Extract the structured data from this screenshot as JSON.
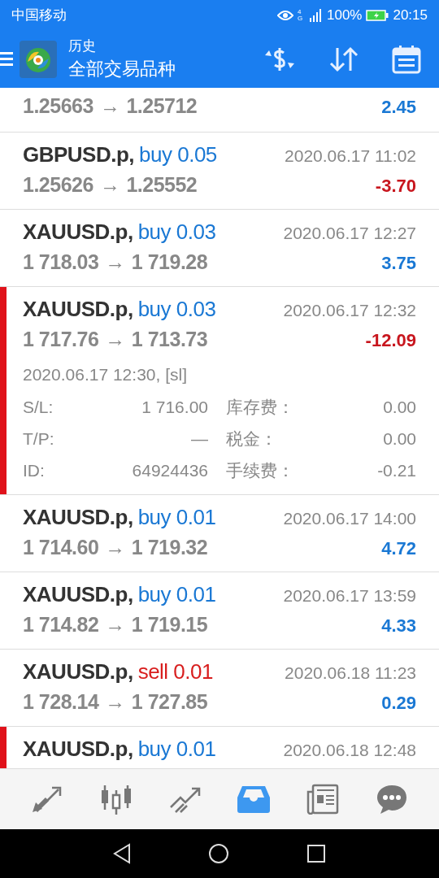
{
  "status_bar": {
    "carrier": "中国移动",
    "network": "4G",
    "battery": "100%",
    "time": "20:15"
  },
  "header": {
    "title": "历史",
    "subtitle": "全部交易品种"
  },
  "trades": [
    {
      "marked": false,
      "price_open": "1.25663",
      "arrow": "→",
      "price_close": "1.25712",
      "profit": "2.45",
      "loss": false
    },
    {
      "marked": false,
      "symbol": "GBPUSD.p,",
      "kind": "buy",
      "order": "buy 0.05",
      "time": "2020.06.17 11:02",
      "price_open": "1.25626",
      "arrow": "→",
      "price_close": "1.25552",
      "profit": "-3.70",
      "loss": true
    },
    {
      "marked": false,
      "symbol": "XAUUSD.p,",
      "kind": "buy",
      "order": "buy 0.03",
      "time": "2020.06.17 12:27",
      "price_open": "1 718.03",
      "arrow": "→",
      "price_close": "1 719.28",
      "profit": "3.75",
      "loss": false
    },
    {
      "marked": true,
      "symbol": "XAUUSD.p,",
      "kind": "buy",
      "order": "buy 0.03",
      "time": "2020.06.17 12:32",
      "price_open": "1 717.76",
      "arrow": "→",
      "price_close": "1 713.73",
      "profit": "-12.09",
      "loss": true,
      "details": {
        "close_info": "2020.06.17 12:30, [sl]",
        "fields": [
          [
            "S/L:",
            "1 716.00",
            "库存费：",
            "0.00"
          ],
          [
            "T/P:",
            "—",
            "税金：",
            "0.00"
          ],
          [
            "ID:",
            "64924436",
            "手续费：",
            "-0.21"
          ]
        ]
      }
    },
    {
      "marked": false,
      "symbol": "XAUUSD.p,",
      "kind": "buy",
      "order": "buy 0.01",
      "time": "2020.06.17 14:00",
      "price_open": "1 714.60",
      "arrow": "→",
      "price_close": "1 719.32",
      "profit": "4.72",
      "loss": false
    },
    {
      "marked": false,
      "symbol": "XAUUSD.p,",
      "kind": "buy",
      "order": "buy 0.01",
      "time": "2020.06.17 13:59",
      "price_open": "1 714.82",
      "arrow": "→",
      "price_close": "1 719.15",
      "profit": "4.33",
      "loss": false
    },
    {
      "marked": false,
      "symbol": "XAUUSD.p,",
      "kind": "sell",
      "order": "sell 0.01",
      "time": "2020.06.18 11:23",
      "price_open": "1 728.14",
      "arrow": "→",
      "price_close": "1 727.85",
      "profit": "0.29",
      "loss": false
    },
    {
      "marked": true,
      "symbol": "XAUUSD.p,",
      "kind": "buy",
      "order": "buy 0.01",
      "time": "2020.06.18 12:48"
    }
  ],
  "bottom_nav": [
    {
      "kind": "trade",
      "selected": false
    },
    {
      "kind": "chart",
      "selected": false
    },
    {
      "kind": "signals",
      "selected": false
    },
    {
      "kind": "history",
      "selected": true
    },
    {
      "kind": "news",
      "selected": false
    },
    {
      "kind": "chat",
      "selected": false
    }
  ]
}
